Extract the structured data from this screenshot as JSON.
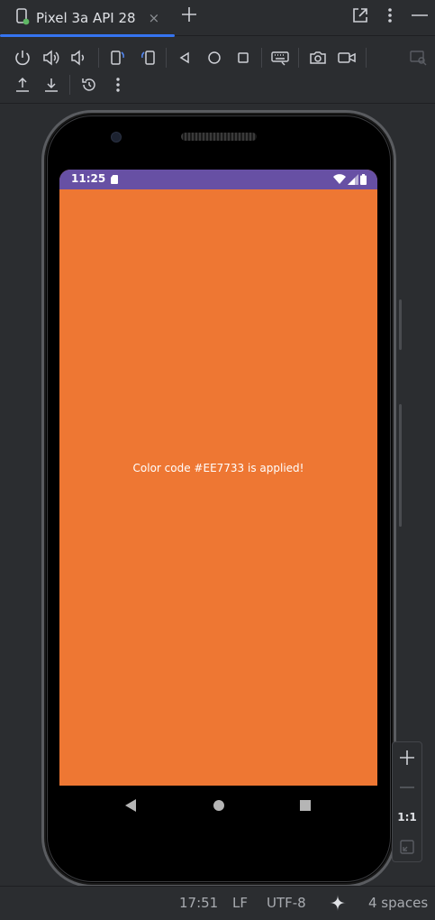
{
  "tabbar": {
    "tab_label": "Pixel 3a API 28",
    "close_glyph": "×",
    "device_icon": "device-icon",
    "add_icon": "plus-icon",
    "external_icon": "external-link-icon",
    "more_icon": "more-vertical-icon",
    "minimize_icon": "minimize-icon"
  },
  "toolbar": {
    "row1": [
      "power-icon",
      "volume-up-icon",
      "volume-down-icon",
      "rotate-left-icon",
      "rotate-right-icon",
      "back-icon",
      "home-icon",
      "overview-icon",
      "keyboard-icon",
      "camera-icon",
      "video-icon",
      "search-disabled-icon"
    ],
    "row2": [
      "upload-icon",
      "download-icon",
      "reset-icon",
      "more-vertical-icon"
    ]
  },
  "device": {
    "status_time": "11:25",
    "app_message": "Color code #EE7733 is applied!",
    "screen_color": "#EE7733",
    "statusbar_color": "#6750A4"
  },
  "zoom": {
    "zoom_in_icon": "plus-icon",
    "zoom_out_icon": "minus-icon",
    "one_to_one": "1:1",
    "fit_icon": "fit-screen-icon"
  },
  "ide_status": {
    "time": "17:51",
    "line_ending": "LF",
    "encoding": "UTF-8",
    "ai_icon": "sparkle-icon",
    "indent": "4 spaces"
  },
  "colors": {
    "accent": "#3574f0",
    "background": "#2b2d30",
    "icon": "#dfe1e5"
  }
}
